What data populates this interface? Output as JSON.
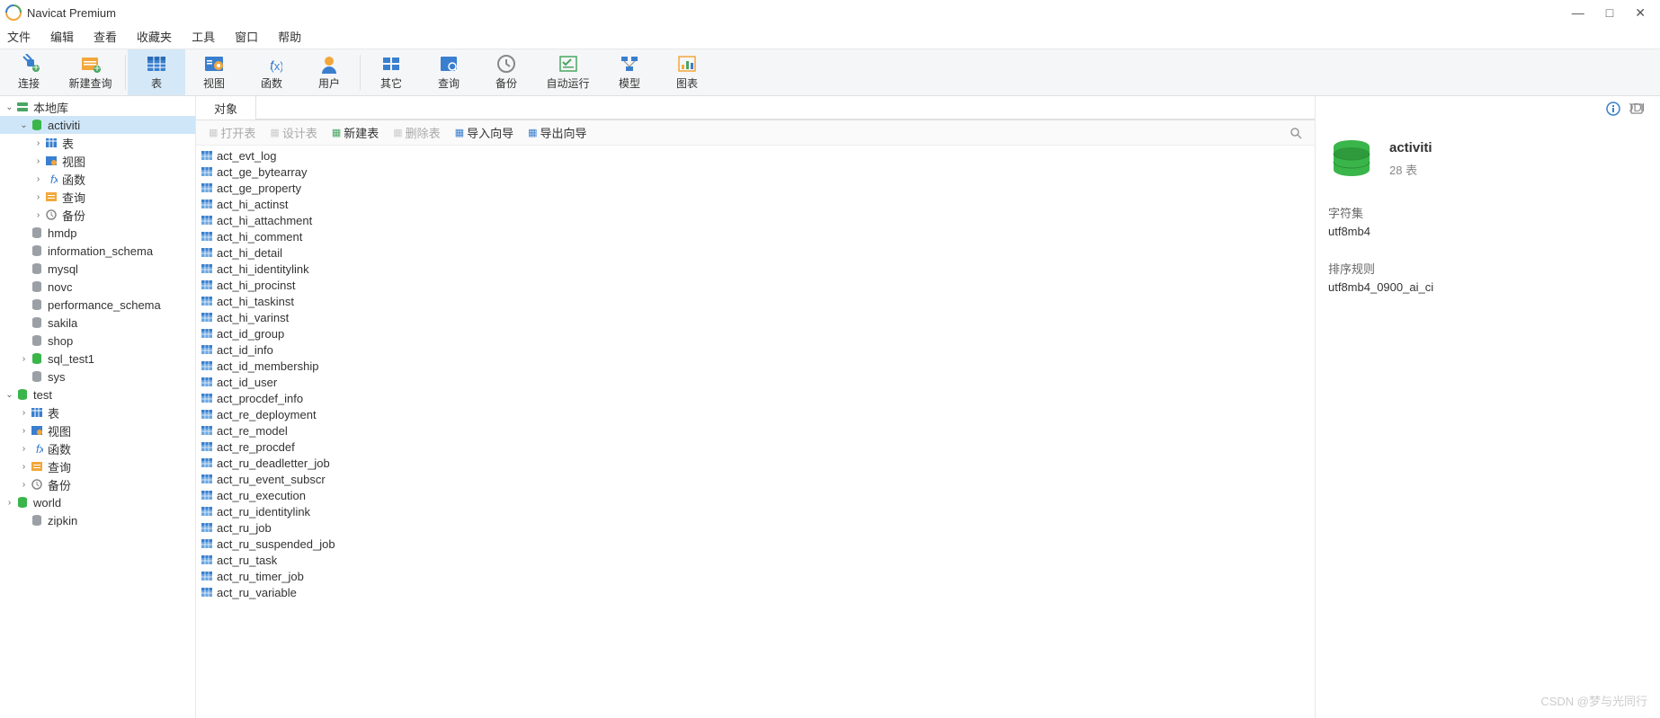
{
  "title": "Navicat Premium",
  "menu": [
    "文件",
    "编辑",
    "查看",
    "收藏夹",
    "工具",
    "窗口",
    "帮助"
  ],
  "toolbar": [
    {
      "label": "连接",
      "icon": "plug",
      "id": "connect"
    },
    {
      "label": "新建查询",
      "icon": "newquery",
      "id": "new-query"
    },
    {
      "sep": true
    },
    {
      "label": "表",
      "icon": "table",
      "id": "table",
      "active": true
    },
    {
      "label": "视图",
      "icon": "view",
      "id": "view"
    },
    {
      "label": "函数",
      "icon": "fx",
      "id": "function"
    },
    {
      "label": "用户",
      "icon": "user",
      "id": "user"
    },
    {
      "sep": true
    },
    {
      "label": "其它",
      "icon": "other",
      "id": "other"
    },
    {
      "label": "查询",
      "icon": "query",
      "id": "query"
    },
    {
      "label": "备份",
      "icon": "backup",
      "id": "backup"
    },
    {
      "label": "自动运行",
      "icon": "auto",
      "id": "auto"
    },
    {
      "label": "模型",
      "icon": "model",
      "id": "model"
    },
    {
      "label": "图表",
      "icon": "chart",
      "id": "chart"
    }
  ],
  "tree": [
    {
      "d": 0,
      "exp": "v",
      "icon": "server",
      "label": "本地库"
    },
    {
      "d": 1,
      "exp": "v",
      "icon": "db-green",
      "label": "activiti",
      "selected": true
    },
    {
      "d": 2,
      "exp": ">",
      "icon": "table-s",
      "label": "表"
    },
    {
      "d": 2,
      "exp": ">",
      "icon": "view-s",
      "label": "视图"
    },
    {
      "d": 2,
      "exp": ">",
      "icon": "fx-s",
      "label": "函数"
    },
    {
      "d": 2,
      "exp": ">",
      "icon": "query-s",
      "label": "查询"
    },
    {
      "d": 2,
      "exp": ">",
      "icon": "backup-s",
      "label": "备份"
    },
    {
      "d": 1,
      "exp": "",
      "icon": "db-gray",
      "label": "hmdp"
    },
    {
      "d": 1,
      "exp": "",
      "icon": "db-gray",
      "label": "information_schema"
    },
    {
      "d": 1,
      "exp": "",
      "icon": "db-gray",
      "label": "mysql"
    },
    {
      "d": 1,
      "exp": "",
      "icon": "db-gray",
      "label": "novc"
    },
    {
      "d": 1,
      "exp": "",
      "icon": "db-gray",
      "label": "performance_schema"
    },
    {
      "d": 1,
      "exp": "",
      "icon": "db-gray",
      "label": "sakila"
    },
    {
      "d": 1,
      "exp": "",
      "icon": "db-gray",
      "label": "shop"
    },
    {
      "d": 1,
      "exp": ">",
      "icon": "db-green",
      "label": "sql_test1"
    },
    {
      "d": 1,
      "exp": "",
      "icon": "db-gray",
      "label": "sys"
    },
    {
      "d": 0,
      "exp": "v",
      "icon": "db-green",
      "label": "test"
    },
    {
      "d": 1,
      "exp": ">",
      "icon": "table-s",
      "label": "表"
    },
    {
      "d": 1,
      "exp": ">",
      "icon": "view-s",
      "label": "视图"
    },
    {
      "d": 1,
      "exp": ">",
      "icon": "fx-s",
      "label": "函数"
    },
    {
      "d": 1,
      "exp": ">",
      "icon": "query-s",
      "label": "查询"
    },
    {
      "d": 1,
      "exp": ">",
      "icon": "backup-s",
      "label": "备份"
    },
    {
      "d": 0,
      "exp": ">",
      "icon": "db-green",
      "label": "world"
    },
    {
      "d": 1,
      "exp": "",
      "icon": "db-gray",
      "label": "zipkin"
    }
  ],
  "tab": {
    "label": "对象"
  },
  "subtoolbar": [
    {
      "label": "打开表",
      "id": "open-table",
      "disabled": true,
      "icon": "open"
    },
    {
      "label": "设计表",
      "id": "design-table",
      "disabled": true,
      "icon": "design"
    },
    {
      "label": "新建表",
      "id": "new-table",
      "strong": true,
      "icon": "new"
    },
    {
      "label": "删除表",
      "id": "delete-table",
      "disabled": true,
      "icon": "delete"
    },
    {
      "label": "导入向导",
      "id": "import",
      "strong": true,
      "icon": "import"
    },
    {
      "label": "导出向导",
      "id": "export",
      "strong": true,
      "icon": "export"
    }
  ],
  "tables": [
    "act_evt_log",
    "act_ge_bytearray",
    "act_ge_property",
    "act_hi_actinst",
    "act_hi_attachment",
    "act_hi_comment",
    "act_hi_detail",
    "act_hi_identitylink",
    "act_hi_procinst",
    "act_hi_taskinst",
    "act_hi_varinst",
    "act_id_group",
    "act_id_info",
    "act_id_membership",
    "act_id_user",
    "act_procdef_info",
    "act_re_deployment",
    "act_re_model",
    "act_re_procdef",
    "act_ru_deadletter_job",
    "act_ru_event_subscr",
    "act_ru_execution",
    "act_ru_identitylink",
    "act_ru_job",
    "act_ru_suspended_job",
    "act_ru_task",
    "act_ru_timer_job",
    "act_ru_variable"
  ],
  "info": {
    "name": "activiti",
    "count": "28 表",
    "charset_label": "字符集",
    "charset_value": "utf8mb4",
    "collation_label": "排序规则",
    "collation_value": "utf8mb4_0900_ai_ci"
  },
  "watermark": "CSDN @梦与光同行"
}
